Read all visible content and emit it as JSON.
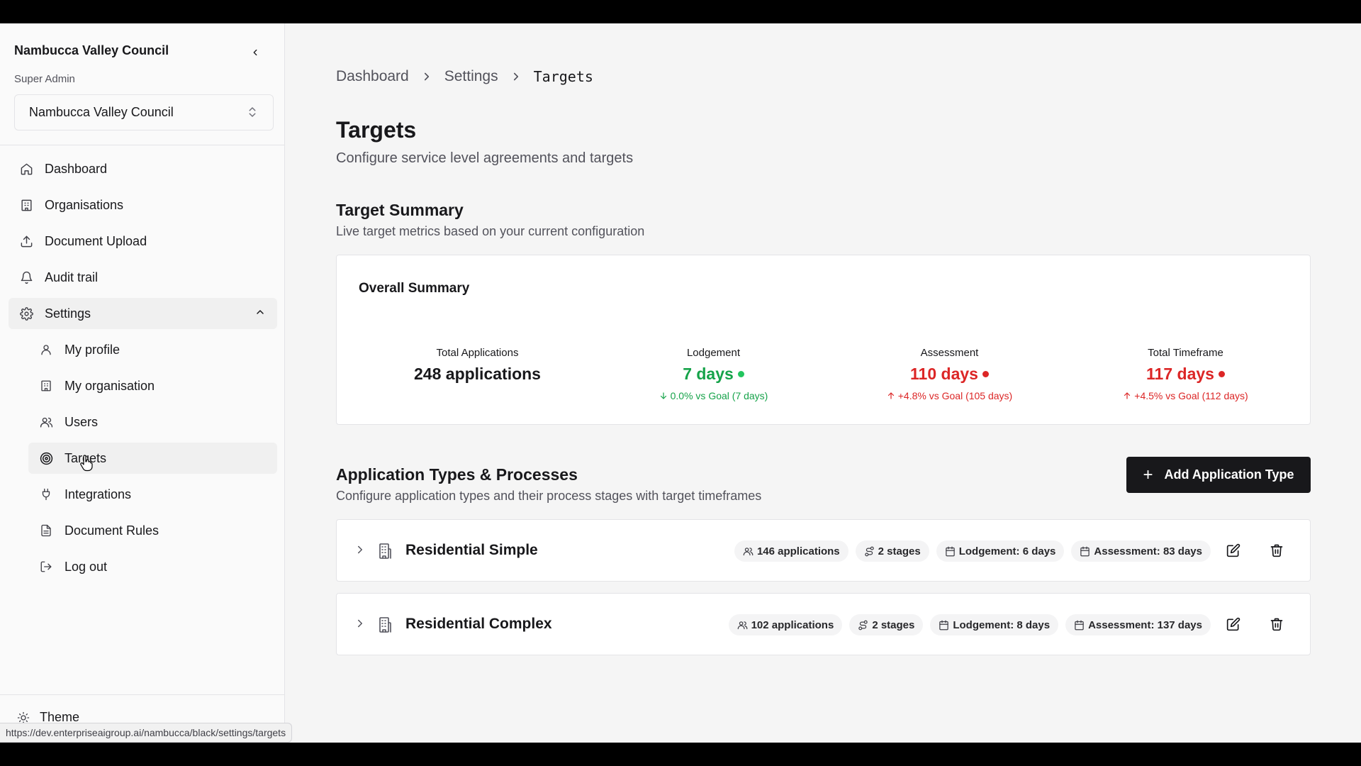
{
  "sidebar": {
    "org_title": "Nambucca Valley Council",
    "role": "Super Admin",
    "org_select_value": "Nambucca Valley Council",
    "nav": [
      {
        "label": "Dashboard",
        "icon": "home-icon"
      },
      {
        "label": "Organisations",
        "icon": "building-icon"
      },
      {
        "label": "Document Upload",
        "icon": "upload-icon"
      },
      {
        "label": "Audit trail",
        "icon": "bell-icon"
      },
      {
        "label": "Settings",
        "icon": "gear-icon"
      }
    ],
    "settings_sub": [
      {
        "label": "My profile",
        "icon": "user-icon"
      },
      {
        "label": "My organisation",
        "icon": "building-icon"
      },
      {
        "label": "Users",
        "icon": "users-icon"
      },
      {
        "label": "Targets",
        "icon": "target-icon"
      },
      {
        "label": "Integrations",
        "icon": "plug-icon"
      },
      {
        "label": "Document Rules",
        "icon": "file-icon"
      },
      {
        "label": "Log out",
        "icon": "logout-icon"
      }
    ],
    "theme_label": "Theme"
  },
  "breadcrumb": [
    "Dashboard",
    "Settings",
    "Targets"
  ],
  "page": {
    "title": "Targets",
    "subtitle": "Configure service level agreements and targets"
  },
  "target_summary": {
    "title": "Target Summary",
    "subtitle": "Live target metrics based on your current configuration",
    "card_title": "Overall Summary",
    "metrics": [
      {
        "label": "Total Applications",
        "value": "248 applications",
        "delta": ""
      },
      {
        "label": "Lodgement",
        "value": "7 days",
        "delta": "0.0% vs Goal (7 days)",
        "status": "good"
      },
      {
        "label": "Assessment",
        "value": "110 days",
        "delta": "+4.8% vs Goal (105 days)",
        "status": "bad"
      },
      {
        "label": "Total Timeframe",
        "value": "117 days",
        "delta": "+4.5% vs Goal (112 days)",
        "status": "bad"
      }
    ]
  },
  "app_types": {
    "title": "Application Types & Processes",
    "subtitle": "Configure application types and their process stages with target timeframes",
    "add_button": "Add Application Type",
    "rows": [
      {
        "name": "Residential Simple",
        "applications": "146 applications",
        "stages": "2 stages",
        "lodgement": "Lodgement: 6 days",
        "assessment": "Assessment: 83 days"
      },
      {
        "name": "Residential Complex",
        "applications": "102 applications",
        "stages": "2 stages",
        "lodgement": "Lodgement: 8 days",
        "assessment": "Assessment: 137 days"
      }
    ]
  },
  "status_url": "https://dev.enterpriseaigroup.ai/nambucca/black/settings/targets",
  "colors": {
    "good": "#16a34a",
    "bad": "#dc2626",
    "primary": "#18181b"
  }
}
